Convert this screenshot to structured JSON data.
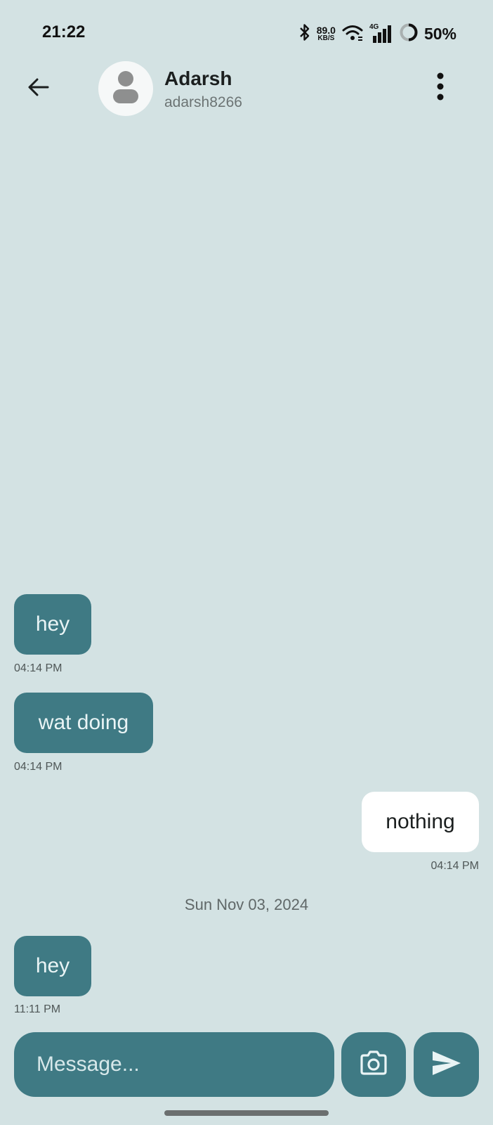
{
  "status_bar": {
    "time": "21:22",
    "net_speed_value": "89.0",
    "net_speed_unit": "KB/S",
    "network_type": "4G",
    "battery_percent": "50%"
  },
  "header": {
    "contact_name": "Adarsh",
    "contact_handle": "adarsh8266"
  },
  "messages": [
    {
      "direction": "in",
      "text": "hey",
      "time": "04:14 PM"
    },
    {
      "direction": "in",
      "text": "wat doing",
      "time": "04:14 PM"
    },
    {
      "direction": "out",
      "text": "nothing",
      "time": "04:14 PM"
    },
    {
      "direction": "in",
      "text": "hey",
      "time": "11:11 PM"
    }
  ],
  "date_separator": "Sun Nov 03, 2024",
  "composer": {
    "placeholder": "Message..."
  },
  "colors": {
    "background": "#d3e2e3",
    "accent": "#3f7a84",
    "outgoing_bubble": "#ffffff"
  },
  "icons": {
    "back": "arrow-left-icon",
    "more": "more-vertical-icon",
    "camera": "camera-icon",
    "send": "send-icon"
  }
}
